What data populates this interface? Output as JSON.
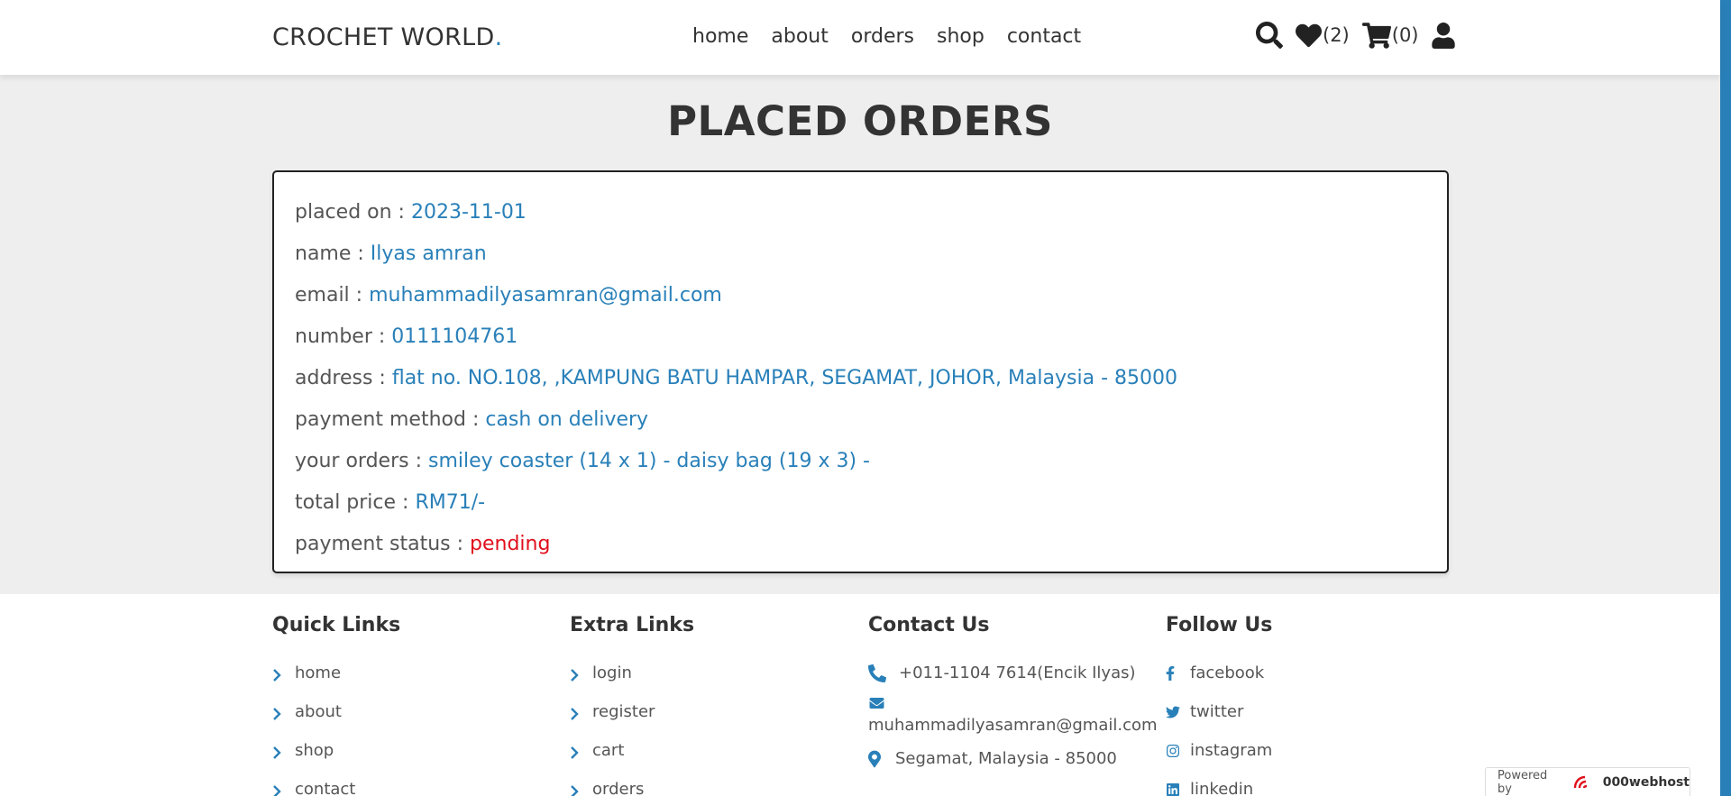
{
  "header": {
    "logo": "CROCHET WORLD",
    "logo_dot": ".",
    "nav": [
      "home",
      "about",
      "orders",
      "shop",
      "contact"
    ],
    "wishlist_count": "(2)",
    "cart_count": "(0)"
  },
  "page": {
    "title": "PLACED ORDERS"
  },
  "order": {
    "placed_on": {
      "label": "placed on : ",
      "value": "2023-11-01"
    },
    "name": {
      "label": "name : ",
      "value": "Ilyas amran"
    },
    "email": {
      "label": "email : ",
      "value": "muhammadilyasamran@gmail.com"
    },
    "number": {
      "label": "number : ",
      "value": "0111104761"
    },
    "address": {
      "label": "address : ",
      "value": "flat no. NO.108, ,KAMPUNG BATU HAMPAR, SEGAMAT, JOHOR, Malaysia - 85000"
    },
    "payment_method": {
      "label": "payment method : ",
      "value": "cash on delivery"
    },
    "your_orders": {
      "label": "your orders : ",
      "value": "smiley coaster (14 x 1) - daisy bag (19 x 3) -"
    },
    "total_price": {
      "label": "total price : ",
      "value": "RM71/-"
    },
    "payment_status": {
      "label": "payment status : ",
      "value": "pending"
    }
  },
  "footer": {
    "quick_links": {
      "title": "Quick Links",
      "items": [
        "home",
        "about",
        "shop",
        "contact"
      ]
    },
    "extra_links": {
      "title": "Extra Links",
      "items": [
        "login",
        "register",
        "cart",
        "orders"
      ]
    },
    "contact": {
      "title": "Contact Us",
      "phone": "+011-1104 7614(Encik Ilyas)",
      "email": "muhammadilyasamran@gmail.com",
      "location": "Segamat, Malaysia - 85000"
    },
    "follow": {
      "title": "Follow Us",
      "items": [
        "facebook",
        "twitter",
        "instagram",
        "linkedin"
      ]
    }
  },
  "badge": {
    "powered": "Powered by",
    "brand": "000webhost"
  },
  "colors": {
    "accent": "#2980b9",
    "danger": "#e0101d",
    "background": "#eeeeee"
  }
}
